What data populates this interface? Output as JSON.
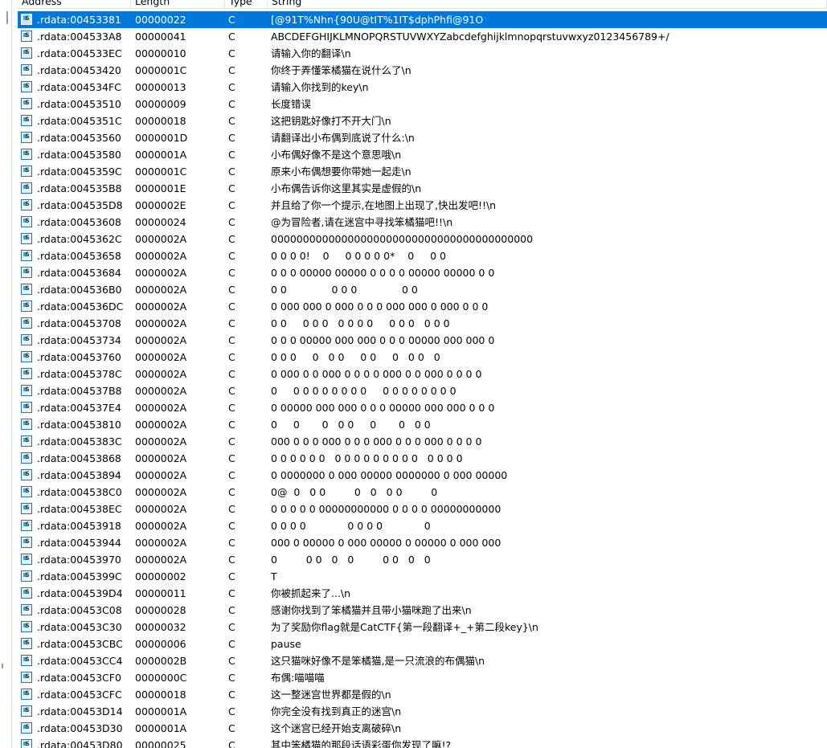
{
  "columns": {
    "address": "Address",
    "length": "Length",
    "type": "Type",
    "string": "String"
  },
  "rows": [
    {
      "address": ".rdata:00453381",
      "length": "00000022",
      "type": "C",
      "string": "[@91T%Nhn{90U@tIT%1IT$dphPhfi@91O",
      "selected": true
    },
    {
      "address": ".rdata:004533A8",
      "length": "00000041",
      "type": "C",
      "string": "ABCDEFGHIJKLMNOPQRSTUVWXYZabcdefghijklmnopqrstuvwxyz0123456789+/"
    },
    {
      "address": ".rdata:004533EC",
      "length": "00000010",
      "type": "C",
      "string": "请输入你的翻译\\n"
    },
    {
      "address": ".rdata:00453420",
      "length": "0000001C",
      "type": "C",
      "string": "你终于弄懂笨橘猫在说什么了\\n"
    },
    {
      "address": ".rdata:004534FC",
      "length": "00000013",
      "type": "C",
      "string": "请输入你找到的key\\n"
    },
    {
      "address": ".rdata:00453510",
      "length": "00000009",
      "type": "C",
      "string": "长度错误"
    },
    {
      "address": ".rdata:0045351C",
      "length": "00000018",
      "type": "C",
      "string": "这把钥匙好像打不开大门\\n"
    },
    {
      "address": ".rdata:00453560",
      "length": "0000001D",
      "type": "C",
      "string": "请翻译出小布偶到底说了什么:\\n"
    },
    {
      "address": ".rdata:00453580",
      "length": "0000001A",
      "type": "C",
      "string": "小布偶好像不是这个意思哦\\n"
    },
    {
      "address": ".rdata:0045359C",
      "length": "0000001C",
      "type": "C",
      "string": "原来小布偶想要你带她一起走\\n"
    },
    {
      "address": ".rdata:004535B8",
      "length": "0000001E",
      "type": "C",
      "string": "小布偶告诉你这里其实是虚假的\\n"
    },
    {
      "address": ".rdata:004535D8",
      "length": "0000002E",
      "type": "C",
      "string": "并且给了你一个提示,在地图上出现了,快出发吧!!\\n"
    },
    {
      "address": ".rdata:00453608",
      "length": "00000024",
      "type": "C",
      "string": "@为冒险者,请在迷宫中寻找笨橘猫吧!!\\n"
    },
    {
      "address": ".rdata:0045362C",
      "length": "0000002A",
      "type": "C",
      "string": "00000000000000000000000000000000000000000"
    },
    {
      "address": ".rdata:00453658",
      "length": "0000002A",
      "type": "C",
      "string": "0 0 0 0!    0     0 0 0 0 0*    0     0 0"
    },
    {
      "address": ".rdata:00453684",
      "length": "0000002A",
      "type": "C",
      "string": "0 0 0 00000 00000 0 0 0 0 00000 00000 0 0"
    },
    {
      "address": ".rdata:004536B0",
      "length": "0000002A",
      "type": "C",
      "string": "0 0              0 0 0              0 0"
    },
    {
      "address": ".rdata:004536DC",
      "length": "0000002A",
      "type": "C",
      "string": "0 000 000 0 000 0 0 0 000 000 0 000 0 0 0"
    },
    {
      "address": ".rdata:00453708",
      "length": "0000002A",
      "type": "C",
      "string": "0 0     0 0 0   0 0 0 0     0 0 0   0 0 0"
    },
    {
      "address": ".rdata:00453734",
      "length": "0000002A",
      "type": "C",
      "string": "0 0 0 00000 000 000 0 0 0 00000 000 000 0"
    },
    {
      "address": ".rdata:00453760",
      "length": "0000002A",
      "type": "C",
      "string": "0 0 0     0   0 0     0 0     0   0 0   0"
    },
    {
      "address": ".rdata:0045378C",
      "length": "0000002A",
      "type": "C",
      "string": "0 000 0 0 000 0 0 0 0 000 0 0 000 0 0 0 0"
    },
    {
      "address": ".rdata:004537B8",
      "length": "0000002A",
      "type": "C",
      "string": "0     0 0 0 0 0 0 0 0     0 0 0 0 0 0 0 0"
    },
    {
      "address": ".rdata:004537E4",
      "length": "0000002A",
      "type": "C",
      "string": "0 00000 000 000 0 0 0 00000 000 000 0 0 0"
    },
    {
      "address": ".rdata:00453810",
      "length": "0000002A",
      "type": "C",
      "string": "0     0       0   0 0     0       0   0 0"
    },
    {
      "address": ".rdata:0045383C",
      "length": "0000002A",
      "type": "C",
      "string": "000 0 0 0 000 0 0 0 000 0 0 0 000 0 0 0 0"
    },
    {
      "address": ".rdata:00453868",
      "length": "0000002A",
      "type": "C",
      "string": "0 0 0 0 0 0   0 0 0 0 0 0 0 0 0   0 0 0 0"
    },
    {
      "address": ".rdata:00453894",
      "length": "0000002A",
      "type": "C",
      "string": "0 0000000 0 000 00000 0000000 0 000 00000"
    },
    {
      "address": ".rdata:004538C0",
      "length": "0000002A",
      "type": "C",
      "string": "0@  0   0 0         0   0   0 0         0"
    },
    {
      "address": ".rdata:004538EC",
      "length": "0000002A",
      "type": "C",
      "string": "0 0 0 0 0 00000000000 0 0 0 0 00000000000"
    },
    {
      "address": ".rdata:00453918",
      "length": "0000002A",
      "type": "C",
      "string": "0 0 0 0             0 0 0 0             0"
    },
    {
      "address": ".rdata:00453944",
      "length": "0000002A",
      "type": "C",
      "string": "000 0 00000 0 000 00000 0 00000 0 000 000"
    },
    {
      "address": ".rdata:00453970",
      "length": "0000002A",
      "type": "C",
      "string": "0         0 0   0   0         0 0   0   0"
    },
    {
      "address": ".rdata:0045399C",
      "length": "00000002",
      "type": "C",
      "string": "T"
    },
    {
      "address": ".rdata:004539D4",
      "length": "00000011",
      "type": "C",
      "string": "你被抓起来了...\\n"
    },
    {
      "address": ".rdata:00453C08",
      "length": "00000028",
      "type": "C",
      "string": "感谢你找到了笨橘猫并且带小猫咪跑了出来\\n"
    },
    {
      "address": ".rdata:00453C30",
      "length": "00000032",
      "type": "C",
      "string": "为了奖励你flag就是CatCTF{第一段翻译+_+第二段key}\\n"
    },
    {
      "address": ".rdata:00453CBC",
      "length": "00000006",
      "type": "C",
      "string": "pause"
    },
    {
      "address": ".rdata:00453CC4",
      "length": "0000002B",
      "type": "C",
      "string": "这只猫咪好像不是笨橘猫,是一只流浪的布偶猫\\n"
    },
    {
      "address": ".rdata:00453CF0",
      "length": "0000000C",
      "type": "C",
      "string": "布偶:喵喵喵"
    },
    {
      "address": ".rdata:00453CFC",
      "length": "00000018",
      "type": "C",
      "string": "这一整迷宫世界都是假的\\n"
    },
    {
      "address": ".rdata:00453D14",
      "length": "0000001A",
      "type": "C",
      "string": "你完全没有找到真正的迷宫\\n"
    },
    {
      "address": ".rdata:00453D30",
      "length": "0000001A",
      "type": "C",
      "string": "这个迷宫已经开始支离破碎\\n"
    },
    {
      "address": ".rdata:00453D80",
      "length": "00000025",
      "type": "C",
      "string": "其中笨橘猫的那段话语彩蛋你发现了嘛!?"
    }
  ]
}
